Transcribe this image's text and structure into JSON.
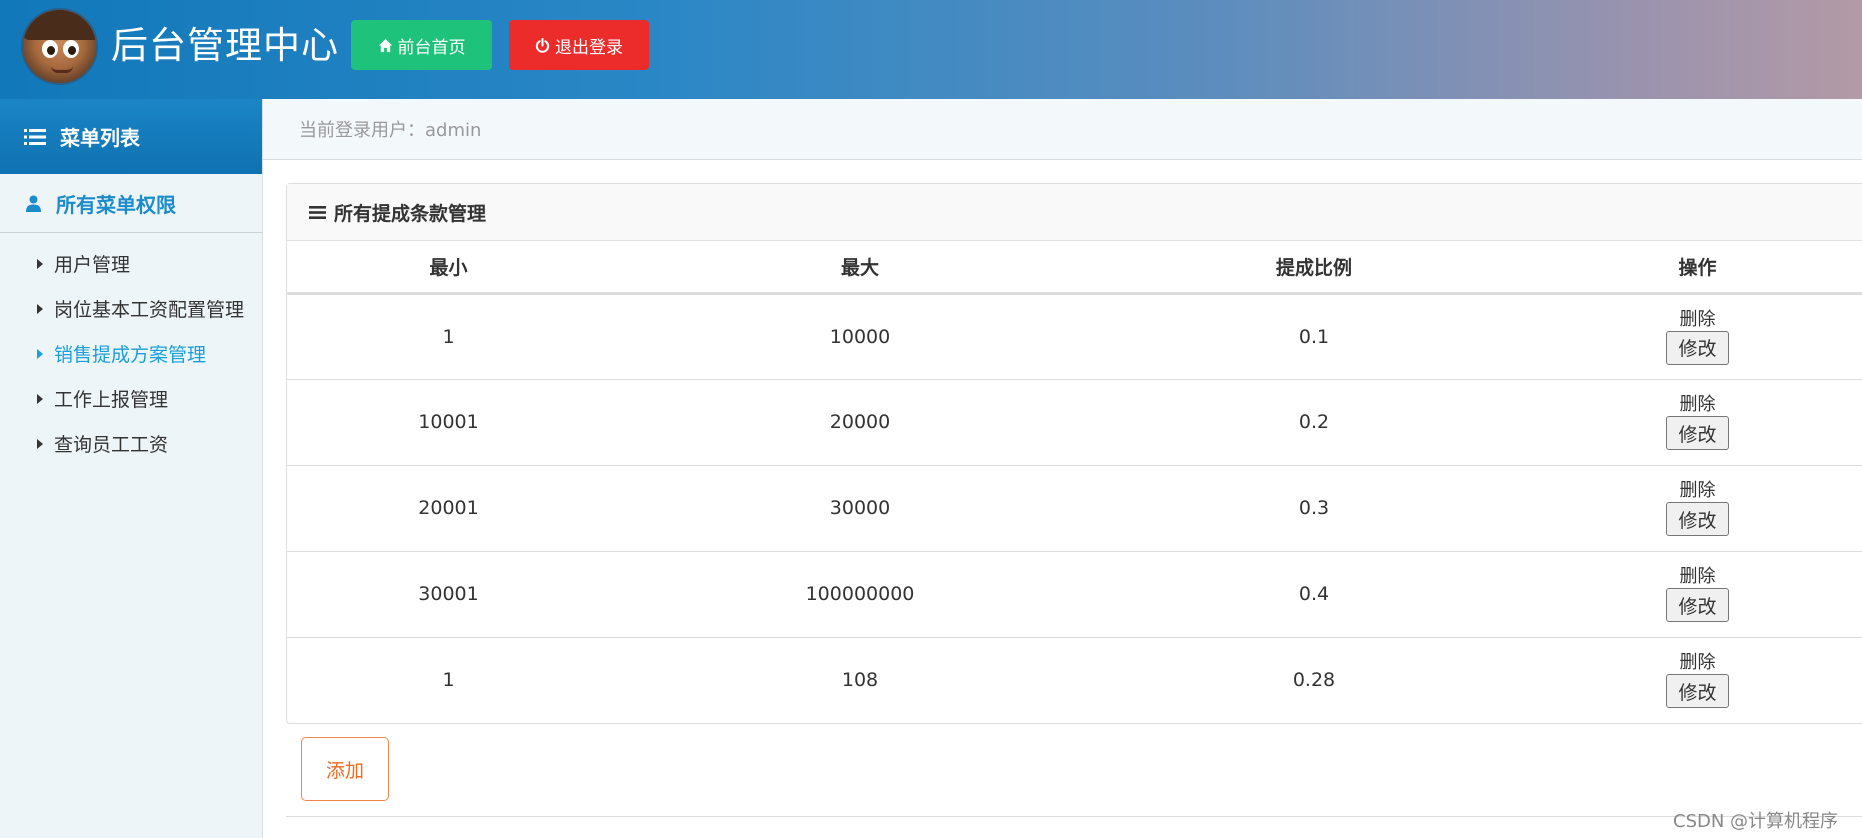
{
  "header": {
    "title": "后台管理中心",
    "home_button": "前台首页",
    "logout_button": "退出登录",
    "colors": {
      "home": "#1ec27a",
      "logout": "#ec2b2b"
    }
  },
  "sidebar": {
    "menu_title": "菜单列表",
    "section_title": "所有菜单权限",
    "items": [
      {
        "label": "用户管理",
        "active": false
      },
      {
        "label": "岗位基本工资配置管理",
        "active": false
      },
      {
        "label": "销售提成方案管理",
        "active": true
      },
      {
        "label": "工作上报管理",
        "active": false
      },
      {
        "label": "查询员工工资",
        "active": false
      }
    ]
  },
  "userbar": {
    "text": "当前登录用户：admin"
  },
  "panel": {
    "title": "所有提成条款管理",
    "columns": [
      "最小",
      "最大",
      "提成比例",
      "操作"
    ],
    "rows": [
      {
        "min": "1",
        "max": "10000",
        "ratio": "0.1",
        "delete": "删除",
        "edit": "修改"
      },
      {
        "min": "10001",
        "max": "20000",
        "ratio": "0.2",
        "delete": "删除",
        "edit": "修改"
      },
      {
        "min": "20001",
        "max": "30000",
        "ratio": "0.3",
        "delete": "删除",
        "edit": "修改"
      },
      {
        "min": "30001",
        "max": "100000000",
        "ratio": "0.4",
        "delete": "删除",
        "edit": "修改"
      },
      {
        "min": "1",
        "max": "108",
        "ratio": "0.28",
        "delete": "删除",
        "edit": "修改"
      }
    ],
    "add_button": "添加"
  },
  "watermark": "CSDN @计算机程序",
  "icons": {
    "home": "home-icon",
    "logout": "power-icon",
    "menu": "list-icon",
    "section": "user-icon",
    "panel": "bars-icon"
  }
}
